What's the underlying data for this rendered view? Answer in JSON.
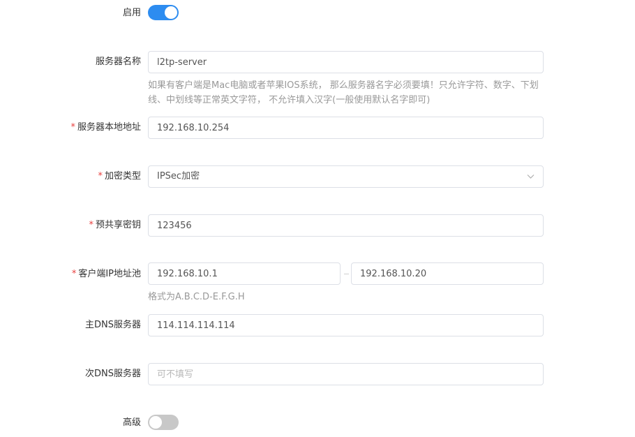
{
  "enable": {
    "label": "启用",
    "on": true
  },
  "server_name": {
    "label": "服务器名称",
    "value": "l2tp-server",
    "hint": "如果有客户端是Mac电脑或者苹果IOS系统， 那么服务器名字必须要填！只允许字符、数字、下划线、中划线等正常英文字符， 不允许填入汉字(一般使用默认名字即可)"
  },
  "local_address": {
    "required_mark": "*",
    "label": "服务器本地地址",
    "value": "192.168.10.254"
  },
  "encryption": {
    "required_mark": "*",
    "label": "加密类型",
    "selected": "IPSec加密",
    "icon": "chevron-down-icon"
  },
  "psk": {
    "required_mark": "*",
    "label": "预共享密钥",
    "value": "123456"
  },
  "client_pool": {
    "required_mark": "*",
    "label": "客户端IP地址池",
    "start": "192.168.10.1",
    "end": "192.168.10.20",
    "hint": "格式为A.B.C.D-E.F.G.H"
  },
  "primary_dns": {
    "label": "主DNS服务器",
    "value": "114.114.114.114"
  },
  "secondary_dns": {
    "label": "次DNS服务器",
    "value": "",
    "placeholder": "可不填写"
  },
  "advanced": {
    "label": "高级",
    "on": false
  },
  "colors": {
    "accent": "#2d8cf0",
    "required": "#e8403f",
    "toggle_off": "#c8c8c8"
  }
}
